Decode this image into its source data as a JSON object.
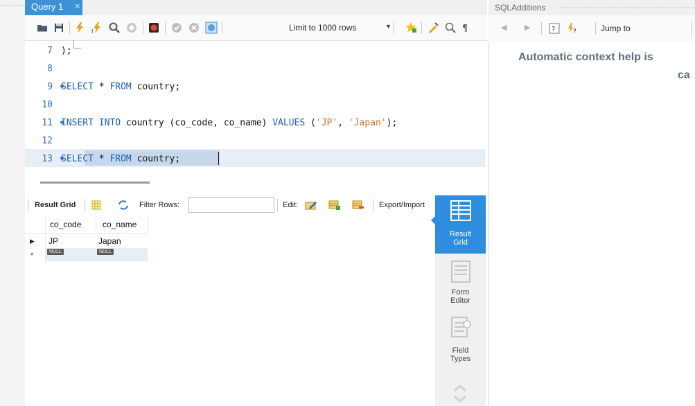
{
  "tab": {
    "title": "Query 1",
    "close": "×"
  },
  "toolbar": {
    "limit_label": "Limit to 1000 rows"
  },
  "editor": {
    "lines": [
      {
        "num": "7",
        "code": ");"
      },
      {
        "num": "8",
        "code": ""
      },
      {
        "num": "9",
        "code": "SELECT * FROM country;"
      },
      {
        "num": "10",
        "code": ""
      },
      {
        "num": "11",
        "code": "INSERT INTO country (co_code, co_name) VALUES ('JP', 'Japan');"
      },
      {
        "num": "12",
        "code": ""
      },
      {
        "num": "13",
        "code": "SELECT * FROM country;"
      }
    ]
  },
  "result_toolbar": {
    "result_grid": "Result Grid",
    "filter_rows": "Filter Rows:",
    "filter_value": "",
    "edit": "Edit:",
    "export": "Export/Import"
  },
  "grid": {
    "columns": [
      "co_code",
      "co_name"
    ],
    "rows": [
      {
        "co_code": "JP",
        "co_name": "Japan"
      }
    ],
    "null_row": {
      "co_code": "NULL",
      "co_name": "NULL"
    }
  },
  "side_tabs": {
    "result_grid": [
      "Result",
      "Grid"
    ],
    "form_editor": [
      "Form",
      "Editor"
    ],
    "field_types": [
      "Field",
      "Types"
    ]
  },
  "sql_additions": {
    "title": "SQLAdditions",
    "jump_to": "Jump to",
    "help_line1": "Automatic context help is",
    "help_line2": "ca"
  },
  "colors": {
    "accent": "#3e91d6",
    "keyword": "#1d5fbf",
    "string": "#d0722a",
    "line_number": "#3a6fb0"
  }
}
